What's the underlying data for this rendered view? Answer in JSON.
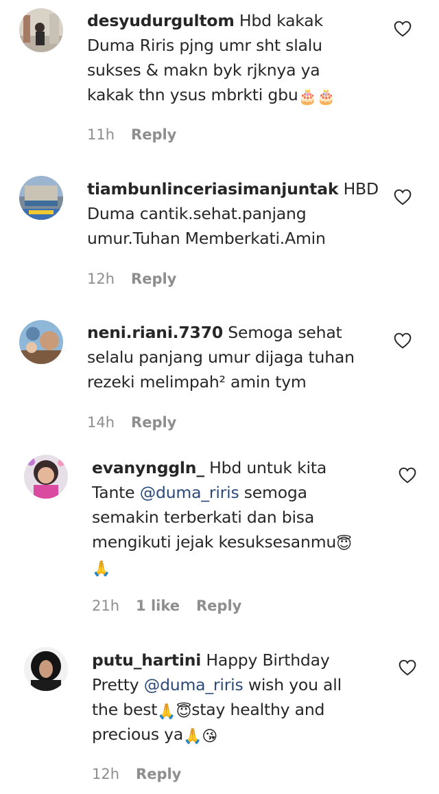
{
  "comments": [
    {
      "username": "desyudurgultom",
      "lines": [
        [
          {
            "t": "Hbd kakak"
          }
        ],
        [
          {
            "t": "Duma Riris pjng umr sht slalu"
          }
        ],
        [
          {
            "t": "sukses & makn byk rjknya ya"
          }
        ],
        [
          {
            "t": "kakak thn ysus mbrkti gbu"
          },
          {
            "e": "🎂"
          },
          {
            "e": "🎂"
          }
        ]
      ],
      "time": "11h",
      "likes": "",
      "reply": "Reply"
    },
    {
      "username": "tiambunlinceriasimanjuntak",
      "lines": [
        [
          {
            "t": "HBD"
          }
        ],
        [
          {
            "t": "Duma cantik.sehat.panjang"
          }
        ],
        [
          {
            "t": "umur.Tuhan Memberkati.Amin"
          }
        ]
      ],
      "time": "12h",
      "likes": "",
      "reply": "Reply"
    },
    {
      "username": "neni.riani.7370",
      "lines": [
        [
          {
            "t": "Semoga sehat"
          }
        ],
        [
          {
            "t": "selalu panjang umur dijaga tuhan"
          }
        ],
        [
          {
            "t": "rezeki melimpah² amin tym"
          }
        ]
      ],
      "time": "14h",
      "likes": "",
      "reply": "Reply"
    },
    {
      "username": "evanynggln_",
      "lines": [
        [
          {
            "t": "Hbd untuk kita"
          }
        ],
        [
          {
            "t": "Tante "
          },
          {
            "m": "@duma_riris"
          },
          {
            "t": " semoga"
          }
        ],
        [
          {
            "t": "semakin terberkati dan bisa"
          }
        ],
        [
          {
            "t": "mengikuti jejak kesuksesanmu"
          },
          {
            "e": "😇"
          }
        ],
        [
          {
            "e": "🙏"
          }
        ]
      ],
      "time": "21h",
      "likes": "1 like",
      "reply": "Reply"
    },
    {
      "username": "putu_hartini",
      "lines": [
        [
          {
            "t": "Happy Birthday"
          }
        ],
        [
          {
            "t": "Pretty "
          },
          {
            "m": "@duma_riris"
          },
          {
            "t": " wish you all"
          }
        ],
        [
          {
            "t": "the best"
          },
          {
            "e": "🙏"
          },
          {
            "e": "😇"
          },
          {
            "t": "stay healthy and"
          }
        ],
        [
          {
            "t": "precious ya"
          },
          {
            "e": "🙏"
          },
          {
            "e": "😘"
          }
        ]
      ],
      "time": "12h",
      "likes": "",
      "reply": "Reply"
    }
  ],
  "colors": {
    "text": "#262626",
    "meta": "#8e8e8e",
    "mention": "#2b4a7a"
  },
  "icons": {
    "like": "heart-outline-icon"
  }
}
